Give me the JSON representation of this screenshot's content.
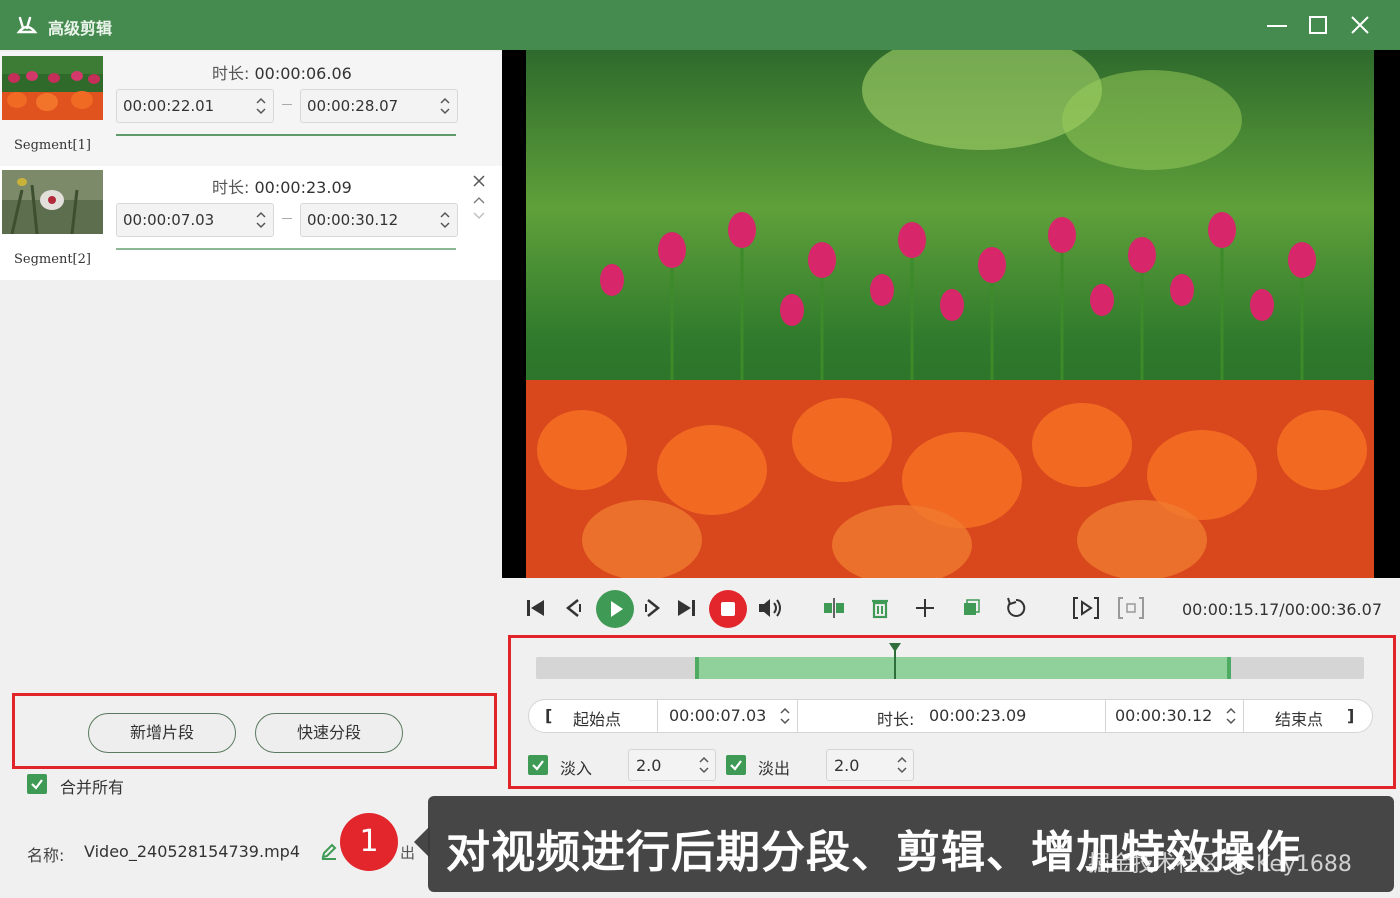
{
  "app": {
    "title": "高级剪辑"
  },
  "segments": [
    {
      "label": "Segment[1]",
      "duration_key": "时长:",
      "duration": "00:00:06.06",
      "start": "00:00:22.01",
      "end": "00:00:28.07"
    },
    {
      "label": "Segment[2]",
      "duration_key": "时长:",
      "duration": "00:00:23.09",
      "start": "00:00:07.03",
      "end": "00:00:30.12"
    }
  ],
  "buttons": {
    "add_segment": "新增片段",
    "quick_segment": "快速分段"
  },
  "merge": {
    "label": "合并所有",
    "checked": true
  },
  "output": {
    "name_label": "名称:",
    "name_value": "Video_240528154739.mp4",
    "export_hint": "出"
  },
  "badge": {
    "number": "1"
  },
  "player": {
    "time_readout": "00:00:15.17/00:00:36.07",
    "icons": [
      "skip-start-icon",
      "step-back-icon",
      "play-icon",
      "step-forward-icon",
      "skip-end-icon",
      "stop-icon",
      "volume-icon",
      "split-icon",
      "delete-icon",
      "add-icon",
      "copy-icon",
      "reset-icon",
      "mark-in-icon",
      "snapshot-icon"
    ]
  },
  "timeline": {
    "selection_start_fraction": 0.192,
    "selection_end_fraction": 0.839,
    "playhead_fraction": 0.434
  },
  "range": {
    "start_button": "起始点",
    "start_bracket": "[",
    "start_time": "00:00:07.03",
    "duration_label": "时长:",
    "duration": "00:00:23.09",
    "end_time": "00:00:30.12",
    "end_button": "结束点",
    "end_bracket": "]"
  },
  "fade": {
    "in_label": "淡入",
    "in_value": "2.0",
    "in_checked": true,
    "out_label": "淡出",
    "out_value": "2.0",
    "out_checked": true
  },
  "caption": {
    "text": "对视频进行后期分段、剪辑、增加特效操作",
    "watermark": "掘金技术社区 @ Key1688"
  },
  "colors": {
    "titlebar": "#458a4f",
    "accent_green": "#3f9a55",
    "highlight_red": "#e0242a",
    "selection": "#8fd09b"
  }
}
